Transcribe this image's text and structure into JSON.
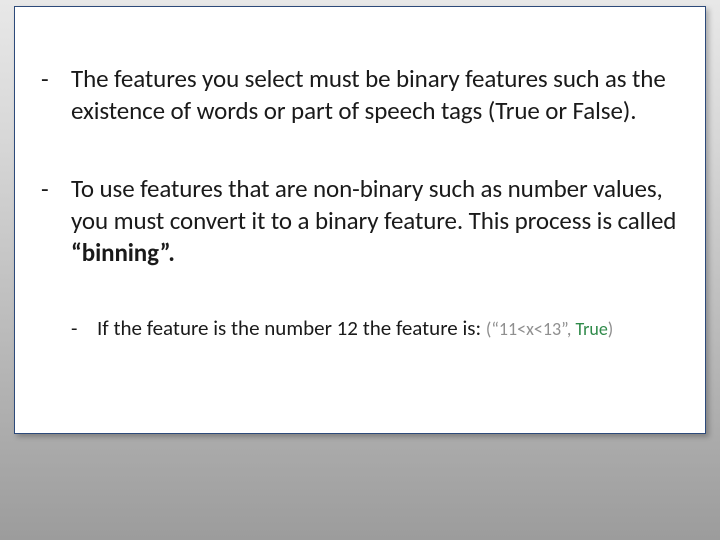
{
  "bullets": [
    {
      "dash": "-",
      "text": "The features you select must be binary features such as the existence of words or part of speech tags (True or False)."
    },
    {
      "dash": "-",
      "prefix": "To use features that are non-binary such as number values, you must convert it to a binary feature. This process is called ",
      "bold": "“binning”.",
      "suffix": ""
    }
  ],
  "sub": {
    "dash": "-",
    "lead": "If the feature is the number 12 the feature is: ",
    "paren_open": "(",
    "range": "“11<x<13”, ",
    "truev": "True",
    "paren_close": ")"
  }
}
